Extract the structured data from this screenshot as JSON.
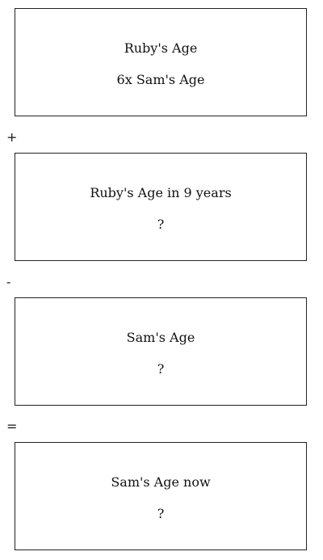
{
  "boxes": [
    {
      "title": "Ruby's Age",
      "value": "6x Sam's Age"
    },
    {
      "title": "Ruby's Age in 9 years",
      "value": "?"
    },
    {
      "title": "Sam's Age",
      "value": "?"
    },
    {
      "title": "Sam's Age now",
      "value": "?"
    }
  ],
  "operators": [
    "+",
    "-",
    "="
  ]
}
